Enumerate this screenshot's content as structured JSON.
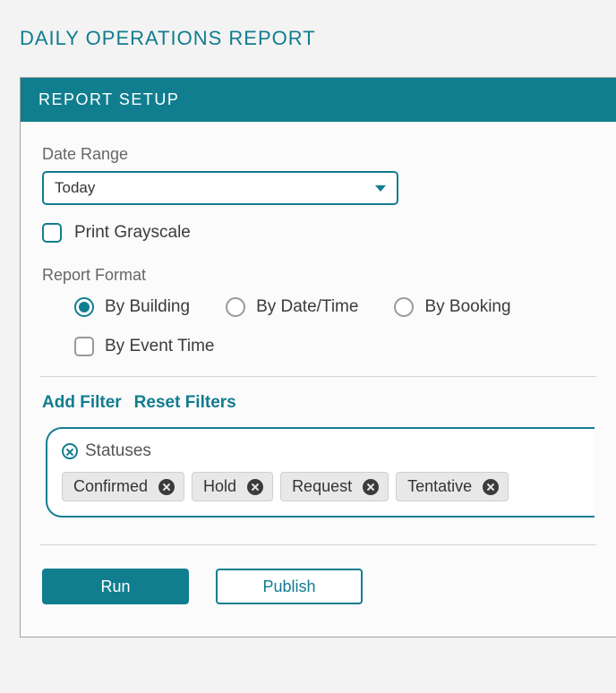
{
  "page": {
    "title": "DAILY OPERATIONS REPORT"
  },
  "panel": {
    "title": "REPORT SETUP"
  },
  "dateRange": {
    "label": "Date Range",
    "value": "Today"
  },
  "printGrayscale": {
    "label": "Print Grayscale",
    "checked": false
  },
  "reportFormat": {
    "label": "Report Format",
    "options": [
      {
        "label": "By Building",
        "selected": true
      },
      {
        "label": "By Date/Time",
        "selected": false
      },
      {
        "label": "By Booking",
        "selected": false
      },
      {
        "label": "By Event Time",
        "selected": false
      }
    ]
  },
  "filters": {
    "addLabel": "Add Filter",
    "resetLabel": "Reset Filters",
    "active": {
      "name": "Statuses",
      "chips": [
        "Confirmed",
        "Hold",
        "Request",
        "Tentative"
      ]
    }
  },
  "buttons": {
    "run": "Run",
    "publish": "Publish"
  },
  "colors": {
    "teal": "#107e8e"
  }
}
